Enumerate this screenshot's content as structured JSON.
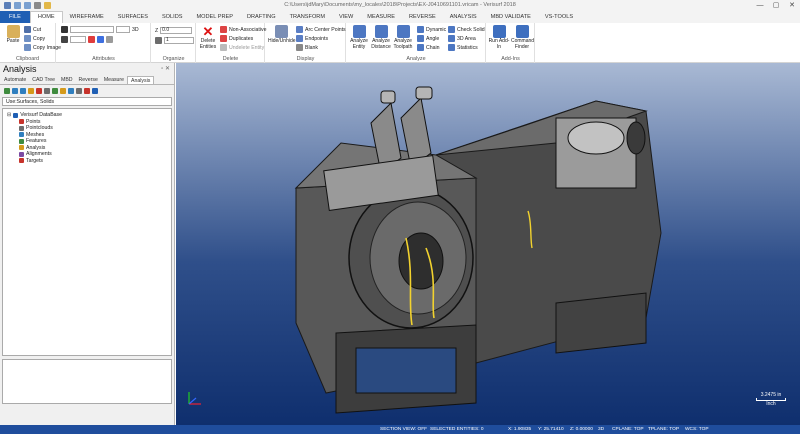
{
  "window": {
    "title": "C:\\Users\\jdMary\\Documents\\my_locales\\2018\\Projects\\EX-J0410691101.vricam - Verisurf 2018",
    "quick_access_icons": [
      "save-icon",
      "undo-icon",
      "redo-icon",
      "print-icon",
      "open-icon"
    ],
    "controls": [
      "—",
      "▢",
      "✕"
    ]
  },
  "ribbon_tabs": [
    "FILE",
    "HOME",
    "WIREFRAME",
    "SURFACES",
    "SOLIDS",
    "MODEL PREP",
    "DRAFTING",
    "TRANSFORM",
    "VIEW",
    "MEASURE",
    "REVERSE",
    "ANALYSIS",
    "MBD VALIDATE",
    "VS-TOOLS"
  ],
  "active_tab": "HOME",
  "ribbon": {
    "clipboard": {
      "label": "Clipboard",
      "paste": "Paste",
      "cut": "Cut",
      "copy": "Copy",
      "copy_image": "Copy Image"
    },
    "attributes": {
      "label": "Attributes",
      "dim_value": "3D"
    },
    "organize": {
      "label": "Organize",
      "z_value": "0.0",
      "level_value": "1"
    },
    "delete": {
      "label": "Delete",
      "delete_entities": "Delete Entities",
      "non_associative": "Non-Associative",
      "duplicates": "Duplicates",
      "undelete": "Undelete Entity"
    },
    "display": {
      "label": "Display",
      "hide_unhide": "Hide/Unhide",
      "arc_center": "Arc Center Points",
      "endpoints": "Endpoints",
      "blank": "Blank"
    },
    "analyze": {
      "label": "Analyze",
      "analyze_entity": "Analyze Entity",
      "analyze_distance": "Analyze Distance",
      "analyze_toolpath": "Analyze Toolpath",
      "dynamic": "Dynamic",
      "angle": "Angle",
      "chain": "Chain",
      "check_solid": "Check Solid",
      "area_3d": "3D Area",
      "statistics": "Statistics"
    },
    "addins": {
      "label": "Add-Ins",
      "run_addin": "Run Add-In",
      "command_finder": "Command Finder"
    }
  },
  "panel": {
    "title": "Analysis",
    "close_glyphs": "▫ ✕",
    "tabs": [
      "Automate",
      "CAD Tree",
      "MBD",
      "Reverse",
      "Measure",
      "Analysis"
    ],
    "active_tab": "Analysis",
    "filter": "Use:Surfaces, Solids",
    "tree": [
      {
        "label": "Verisurf DataBase",
        "level": 0,
        "color": "#1f5fb4"
      },
      {
        "label": "Points",
        "level": 1,
        "color": "#c7332b"
      },
      {
        "label": "Pointclouds",
        "level": 1,
        "color": "#6d6d6d"
      },
      {
        "label": "Meshes",
        "level": 1,
        "color": "#2f7fbf"
      },
      {
        "label": "Features",
        "level": 1,
        "color": "#3e8b3e"
      },
      {
        "label": "Analysis",
        "level": 1,
        "color": "#d59a1b"
      },
      {
        "label": "Alignments",
        "level": 1,
        "color": "#7b4aa3"
      },
      {
        "label": "Targets",
        "level": 1,
        "color": "#c7332b"
      }
    ]
  },
  "viewport": {
    "scale_value": "3.2475 in",
    "scale_unit": "Inch"
  },
  "status": {
    "section_view": "SECTION VIEW: OFF",
    "selected": "SELECTED ENTITIES: 0",
    "x": "X: 1.90835",
    "y": "Y: 25.71410",
    "z": "Z: 0.00000",
    "mode": "3D",
    "cplane": "CPLANE: TOP",
    "tplane": "TPLANE: TOP",
    "wcs": "WCS: TOP"
  },
  "colors": {
    "accent": "#1f5fb4",
    "status_bar": "#1f4d9c",
    "viewport_top": "#a9b9d4",
    "viewport_bottom": "#0f2f6e"
  }
}
